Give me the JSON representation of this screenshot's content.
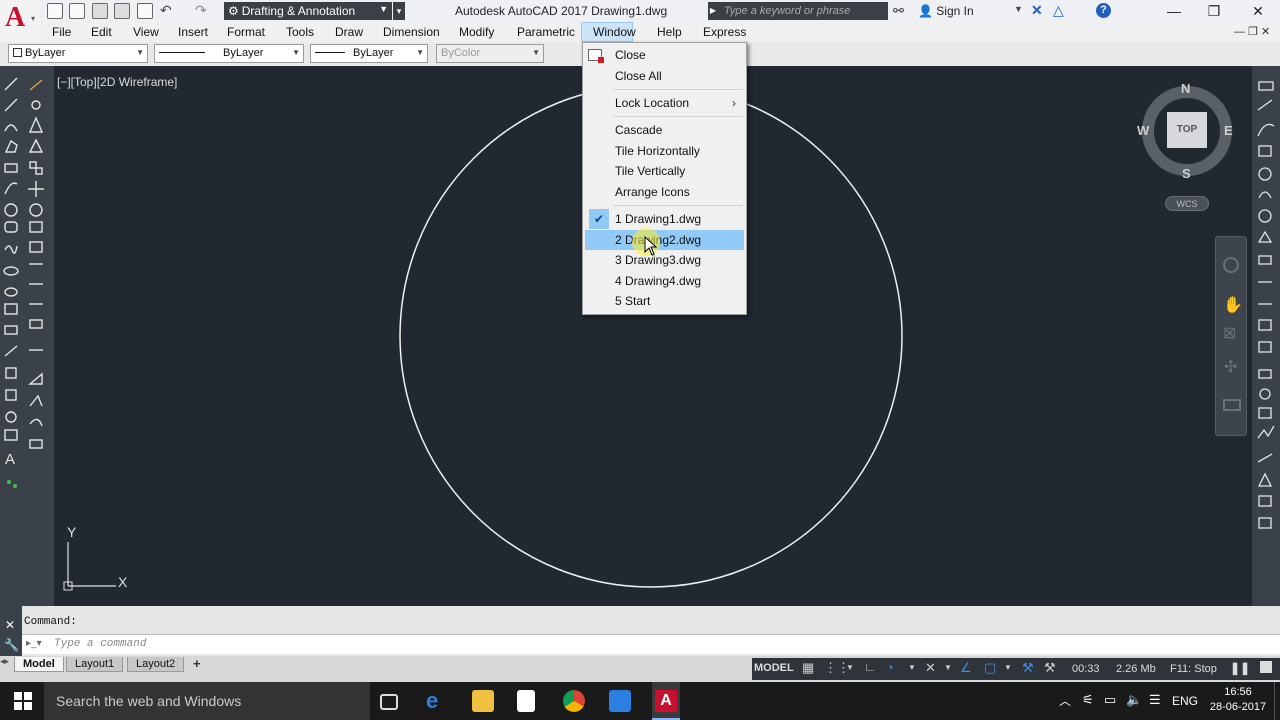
{
  "titlebar": {
    "app_name": "A",
    "workspace": "Drafting & Annotation",
    "title": "Autodesk AutoCAD 2017   Drawing1.dwg",
    "search_placeholder": "Type a keyword or phrase",
    "signin": "Sign In"
  },
  "menubar": {
    "items": [
      "File",
      "Edit",
      "View",
      "Insert",
      "Format",
      "Tools",
      "Draw",
      "Dimension",
      "Modify",
      "Parametric",
      "Window",
      "Help",
      "Express"
    ],
    "active": "Window"
  },
  "properties": {
    "layer": "ByLayer",
    "linetype": "ByLayer",
    "lineweight": "ByLayer",
    "plotstyle": "ByColor"
  },
  "viewport": {
    "label": "[−][Top][2D Wireframe]"
  },
  "viewcube": {
    "top": "TOP",
    "north": "N",
    "south": "S",
    "east": "E",
    "west": "W",
    "wcs": "WCS"
  },
  "ucs": {
    "x_label": "X",
    "y_label": "Y"
  },
  "window_menu": {
    "close": "Close",
    "close_all": "Close All",
    "lock_location": "Lock Location",
    "cascade": "Cascade",
    "tile_horizontally": "Tile Horizontally",
    "tile_vertically": "Tile Vertically",
    "arrange_icons": "Arrange Icons",
    "drawings": [
      "1 Drawing1.dwg",
      "2 Drawing2.dwg",
      "3 Drawing3.dwg",
      "4 Drawing4.dwg",
      "5 Start"
    ],
    "checked_index": 0,
    "hover_index": 1
  },
  "command": {
    "history": "Command:",
    "placeholder": "Type a command"
  },
  "layout_tabs": [
    "Model",
    "Layout1",
    "Layout2"
  ],
  "status": {
    "model": "MODEL",
    "time": "00:33",
    "memory": "2.26 Mb",
    "f11": "F11: Stop"
  },
  "taskbar": {
    "search": "Search the web and Windows",
    "lang": "ENG",
    "time": "16:56",
    "date": "28-06-2017"
  },
  "colors": {
    "canvas": "#212830",
    "highlight": "#91c9f7",
    "autocad_red": "#c8102e"
  }
}
